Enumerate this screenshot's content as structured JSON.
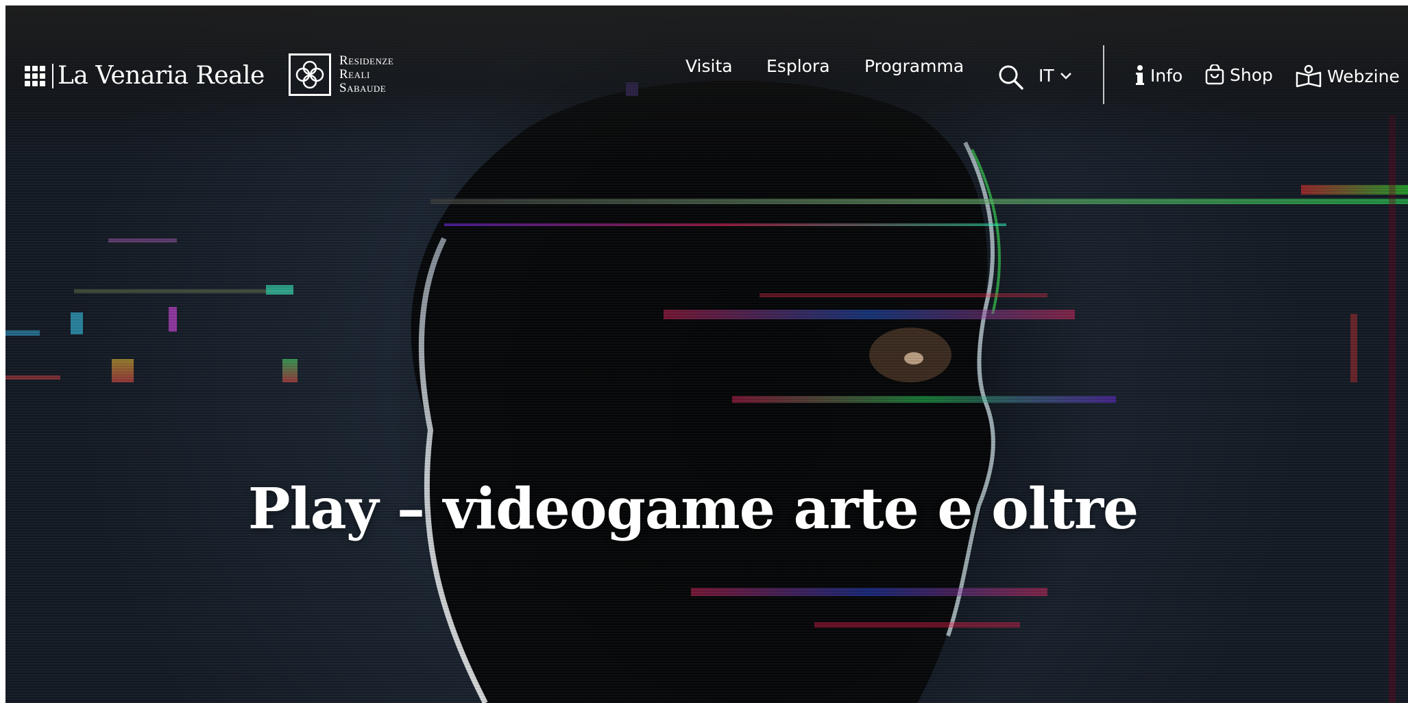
{
  "brand": {
    "venaria_name": "La Venaria Reale",
    "residenze_lines": [
      "Residenze",
      "Reali",
      "Sabaude"
    ]
  },
  "nav": {
    "items": [
      {
        "label": "Visita"
      },
      {
        "label": "Esplora"
      },
      {
        "label": "Programma"
      }
    ],
    "language": "IT"
  },
  "utility": {
    "info": "Info",
    "shop": "Shop",
    "webzine": "Webzine"
  },
  "hero": {
    "title": "Play – videogame arte e oltre"
  },
  "colors": {
    "text": "#ffffff",
    "background": "#1a2230"
  }
}
